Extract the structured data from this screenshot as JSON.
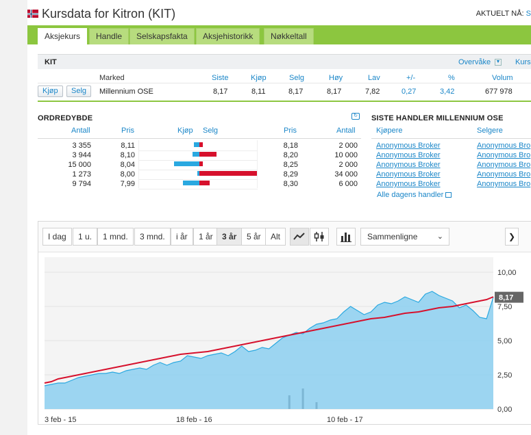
{
  "header": {
    "title": "Kursdata for Kitron (KIT)",
    "current_label": "AKTUELT NÅ:",
    "current_link": "S"
  },
  "tabs": [
    {
      "label": "Aksjekurs",
      "active": true
    },
    {
      "label": "Handle"
    },
    {
      "label": "Selskapsfakta"
    },
    {
      "label": "Aksjehistorikk"
    },
    {
      "label": "Nøkkeltall"
    }
  ],
  "quote": {
    "ticker": "KIT",
    "watch_label": "Overvåke",
    "kurs_label": "Kurs",
    "headers": {
      "market": "Marked",
      "last": "Siste",
      "buy": "Kjøp",
      "sell": "Selg",
      "high": "Høy",
      "low": "Lav",
      "change": "+/-",
      "pct": "%",
      "volume": "Volum"
    },
    "buy_button": "Kjøp",
    "sell_button": "Selg",
    "row": {
      "market": "Millennium OSE",
      "last": "8,17",
      "buy": "8,11",
      "sell": "8,17",
      "high": "8,17",
      "low": "7,82",
      "change": "0,27",
      "pct": "3,42",
      "volume": "677 978"
    }
  },
  "orderbook": {
    "title": "ORDREDYBDE",
    "headers": {
      "bid_qty": "Antall",
      "bid_price": "Pris",
      "buy": "Kjøp",
      "sell": "Selg",
      "ask_price": "Pris",
      "ask_qty": "Antall"
    },
    "rows": [
      {
        "bid_qty": "3 355",
        "bid_price": "8,11",
        "ask_price": "8,18",
        "ask_qty": "2 000",
        "bid_n": 3355,
        "ask_n": 2000
      },
      {
        "bid_qty": "3 944",
        "bid_price": "8,10",
        "ask_price": "8,20",
        "ask_qty": "10 000",
        "bid_n": 3944,
        "ask_n": 10000
      },
      {
        "bid_qty": "15 000",
        "bid_price": "8,04",
        "ask_price": "8,25",
        "ask_qty": "2 000",
        "bid_n": 15000,
        "ask_n": 2000
      },
      {
        "bid_qty": "1 273",
        "bid_price": "8,00",
        "ask_price": "8,29",
        "ask_qty": "34 000",
        "bid_n": 1273,
        "ask_n": 34000
      },
      {
        "bid_qty": "9 794",
        "bid_price": "7,99",
        "ask_price": "8,30",
        "ask_qty": "6 000",
        "bid_n": 9794,
        "ask_n": 6000
      }
    ]
  },
  "trades": {
    "title": "SISTE HANDLER MILLENNIUM OSE",
    "headers": {
      "buyers": "Kjøpere",
      "sellers": "Selgere"
    },
    "rows": [
      {
        "buyer": "Anonymous Broker",
        "seller": "Anonymous Bro"
      },
      {
        "buyer": "Anonymous Broker",
        "seller": "Anonymous Bro"
      },
      {
        "buyer": "Anonymous Broker",
        "seller": "Anonymous Bro"
      },
      {
        "buyer": "Anonymous Broker",
        "seller": "Anonymous Bro"
      },
      {
        "buyer": "Anonymous Broker",
        "seller": "Anonymous Bro"
      }
    ],
    "all_link": "Alle dagens handler"
  },
  "chart_toolbar": {
    "ranges": [
      "I dag",
      "1 u.",
      "1 mnd.",
      "3 mnd.",
      "i år",
      "1 år",
      "3 år",
      "5 år",
      "Alt"
    ],
    "active_range": "3 år",
    "compare_label": "Sammenligne",
    "icons": [
      "line-chart-icon",
      "candlestick-icon",
      "volume-bars-icon"
    ]
  },
  "chart_data": {
    "type": "area",
    "x_labels": [
      "3 feb - 15",
      "18 feb - 16",
      "10 feb - 17"
    ],
    "y_ticks": [
      0,
      2.5,
      5,
      7.5,
      10
    ],
    "y_tick_labels": [
      "0,00",
      "2,50",
      "5,00",
      "7,50",
      "10,00"
    ],
    "ylim": [
      0,
      10.8
    ],
    "last_price_label": "8,17",
    "colors": {
      "area": "#8ccff0",
      "area_line": "#29a8e0",
      "ma": "#d6102c",
      "badge": "#666666"
    },
    "series": [
      {
        "values": [
          1.7,
          1.8,
          1.9,
          1.9,
          2.1,
          2.3,
          2.4,
          2.5,
          2.6,
          2.6,
          2.7,
          2.6,
          2.8,
          2.9,
          3.0,
          2.9,
          3.2,
          3.4,
          3.2,
          3.4,
          3.5,
          3.9,
          3.8,
          3.7,
          3.9,
          4.0,
          4.1,
          3.9,
          4.2,
          4.6,
          4.2,
          4.3,
          4.5,
          4.4,
          4.8,
          5.2,
          5.4,
          5.6,
          5.5,
          5.9,
          6.2,
          6.3,
          6.5,
          6.6,
          7.1,
          7.5,
          7.2,
          6.9,
          7.1,
          7.6,
          7.8,
          7.7,
          7.9,
          8.2,
          8.0,
          7.8,
          8.4,
          8.6,
          8.3,
          8.1,
          7.9,
          7.4,
          7.6,
          7.2,
          6.7,
          6.6,
          8.17
        ]
      },
      {
        "values": [
          1.9,
          2.0,
          2.2,
          2.3,
          2.4,
          2.5,
          2.6,
          2.7,
          2.8,
          2.9,
          3.0,
          3.1,
          3.2,
          3.3,
          3.4,
          3.5,
          3.6,
          3.7,
          3.8,
          3.9,
          4.0,
          4.05,
          4.1,
          4.15,
          4.2,
          4.3,
          4.4,
          4.5,
          4.6,
          4.7,
          4.8,
          4.9,
          5.0,
          5.1,
          5.2,
          5.3,
          5.4,
          5.5,
          5.6,
          5.7,
          5.8,
          5.9,
          6.0,
          6.1,
          6.2,
          6.3,
          6.4,
          6.5,
          6.6,
          6.65,
          6.7,
          6.8,
          6.9,
          7.0,
          7.05,
          7.1,
          7.2,
          7.3,
          7.4,
          7.45,
          7.5,
          7.6,
          7.7,
          7.8,
          7.9,
          8.0,
          8.2
        ]
      }
    ],
    "volume": [
      0,
      0,
      0,
      0,
      0,
      0,
      0,
      0,
      0,
      0,
      0,
      0,
      0,
      0,
      0,
      0,
      0,
      0,
      0,
      0,
      0,
      0,
      0,
      0,
      0,
      0,
      0,
      0,
      0,
      0,
      0,
      0,
      0,
      0,
      0,
      0,
      0.2,
      0,
      0.3,
      0,
      0.1,
      0,
      0,
      0,
      0,
      0,
      0,
      0,
      0,
      0,
      0,
      0,
      0,
      0,
      0,
      0,
      0,
      0,
      0,
      0,
      0,
      0,
      0,
      0,
      0,
      0,
      0
    ]
  }
}
